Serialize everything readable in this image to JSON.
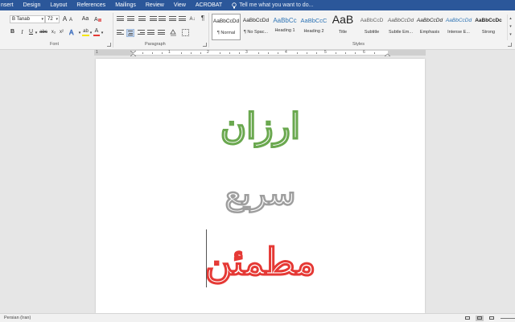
{
  "menu": {
    "tabs": [
      "nsert",
      "Design",
      "Layout",
      "References",
      "Mailings",
      "Review",
      "View",
      "ACROBAT"
    ],
    "tell_me": "Tell me what you want to do..."
  },
  "ribbon": {
    "font_name": "B Tanab",
    "font_size": "72",
    "font_group_label": "Font",
    "paragraph_group_label": "Paragraph",
    "styles_group_label": "Styles",
    "grow_font": "A",
    "shrink_font": "A",
    "case_label": "Aa",
    "bold": "B",
    "italic": "I",
    "underline": "U",
    "strike": "abc",
    "subscript": "x₂",
    "superscript": "x²",
    "font_color_letter": "A",
    "highlight_letter": "ab",
    "styles": [
      {
        "sample": "AaBbCcDd",
        "name": "¶ Normal"
      },
      {
        "sample": "AaBbCcDd",
        "name": "¶ No Spac..."
      },
      {
        "sample": "AaBbCc",
        "name": "Heading 1"
      },
      {
        "sample": "AaBbCcC",
        "name": "Heading 2"
      },
      {
        "sample": "AaB",
        "name": "Title"
      },
      {
        "sample": "AaBbCcD",
        "name": "Subtitle"
      },
      {
        "sample": "AaBbCcDd",
        "name": "Subtle Em..."
      },
      {
        "sample": "AaBbCcDd",
        "name": "Emphasis"
      },
      {
        "sample": "AaBbCcDd",
        "name": "Intense E..."
      },
      {
        "sample": "AaBbCcDc",
        "name": "Strong"
      }
    ]
  },
  "ruler": {
    "numbers": [
      "1",
      "1",
      "2",
      "3",
      "4",
      "5",
      "6"
    ]
  },
  "document": {
    "lines": [
      "ارزان",
      "سریع",
      "مطمئن"
    ],
    "colors": [
      "#6aa84f",
      "#9e9e9e",
      "#e53935"
    ]
  },
  "status": {
    "language": "Persian (Iran)"
  },
  "colors": {
    "accent": "#2b579a"
  }
}
